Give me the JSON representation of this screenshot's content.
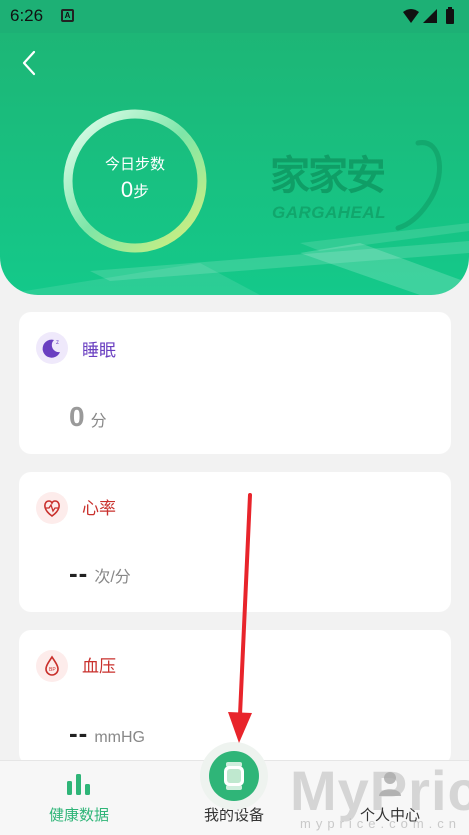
{
  "status": {
    "time": "6:26",
    "notification_glyph": "A"
  },
  "header": {
    "ring_title": "今日步数",
    "steps_value": "0",
    "steps_unit": "步",
    "brand_cn": "家家安",
    "brand_en": "GARGAHEAL"
  },
  "cards": {
    "sleep": {
      "title": "睡眠",
      "value": "0",
      "unit": "分",
      "icon": "moon-icon",
      "color": "#6a3fc1"
    },
    "heart": {
      "title": "心率",
      "value": "--",
      "unit": "次/分",
      "icon": "heart-icon",
      "color": "#c9302c"
    },
    "blood": {
      "title": "血压",
      "value": "--",
      "unit": "mmHG",
      "icon": "blood-drop-icon",
      "color": "#c9302c"
    }
  },
  "tabs": {
    "health": {
      "label": "健康数据",
      "color": "#2fb578"
    },
    "device": {
      "label": "我的设备"
    },
    "profile": {
      "label": "个人中心"
    }
  },
  "watermark": {
    "main": "MyPrice",
    "sub": "myprice.com.cn"
  },
  "colors": {
    "accent": "#1db676",
    "arrow": "#e8242b"
  }
}
